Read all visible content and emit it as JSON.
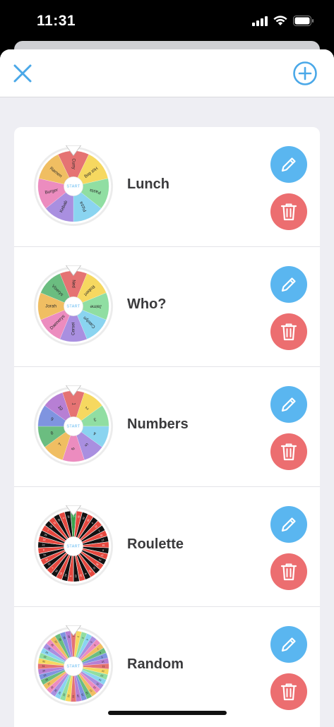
{
  "status_bar": {
    "time": "11:31"
  },
  "nav": {
    "close_icon": "close-icon",
    "add_icon": "plus-circle-icon",
    "accent": "#4aa8e8"
  },
  "start_label": "START",
  "wheels": [
    {
      "name": "Lunch",
      "labels": [
        "Curry",
        "Hot dog",
        "Pasta",
        "Pizza",
        "Kebab",
        "Burger",
        "Ramen"
      ],
      "colors": [
        "#e57373",
        "#f6d860",
        "#90dea2",
        "#8ad4f0",
        "#a98fe0",
        "#ec8cbf",
        "#f0be62"
      ],
      "style": "normal"
    },
    {
      "name": "Who?",
      "labels": [
        "Ned",
        "Robert",
        "Jaime",
        "Catelyn",
        "Cersei",
        "Daenerys",
        "Jorah",
        "Viserys"
      ],
      "colors": [
        "#e57373",
        "#f6d860",
        "#90dea2",
        "#8ad4f0",
        "#a98fe0",
        "#ec8cbf",
        "#f0be62",
        "#6bbd80"
      ],
      "style": "normal"
    },
    {
      "name": "Numbers",
      "labels": [
        "1",
        "2",
        "3",
        "4",
        "5",
        "6",
        "7",
        "8",
        "9",
        "10"
      ],
      "colors": [
        "#e57373",
        "#f6d860",
        "#90dea2",
        "#8ad4f0",
        "#a98fe0",
        "#ec8cbf",
        "#f0be62",
        "#6bbd80",
        "#7f94e0",
        "#b77fd4"
      ],
      "style": "normal"
    },
    {
      "name": "Roulette",
      "labels": [
        "0",
        "32",
        "15",
        "19",
        "4",
        "21",
        "2",
        "25",
        "17",
        "34",
        "6",
        "27",
        "13",
        "36",
        "11",
        "30",
        "8",
        "23",
        "10",
        "5",
        "24",
        "16",
        "33",
        "1",
        "20",
        "14",
        "31",
        "9",
        "22",
        "18",
        "29",
        "7",
        "28",
        "12",
        "35",
        "3",
        "26"
      ],
      "colors": [
        "#e5483f",
        "#111111"
      ],
      "zero_color": "#3aa34e",
      "style": "roulette"
    },
    {
      "name": "Random",
      "labels": [
        "1",
        "2",
        "3",
        "4",
        "5",
        "6",
        "7",
        "8",
        "9",
        "10",
        "11",
        "12",
        "13",
        "14",
        "15",
        "16",
        "17",
        "18",
        "19",
        "20",
        "21",
        "22",
        "23",
        "24",
        "25",
        "26",
        "27",
        "28",
        "29",
        "30",
        "31",
        "32",
        "33",
        "34",
        "35",
        "36",
        "37",
        "38",
        "39",
        "40"
      ],
      "colors": [
        "#e57373",
        "#f6d860",
        "#90dea2",
        "#8ad4f0",
        "#a98fe0",
        "#ec8cbf",
        "#f0be62",
        "#6bbd80",
        "#7f94e0",
        "#b77fd4"
      ],
      "style": "random"
    }
  ],
  "actions": {
    "edit_icon": "pencil-icon",
    "delete_icon": "trash-icon",
    "edit_color": "#5ab6f0",
    "delete_color": "#ec6e70"
  }
}
